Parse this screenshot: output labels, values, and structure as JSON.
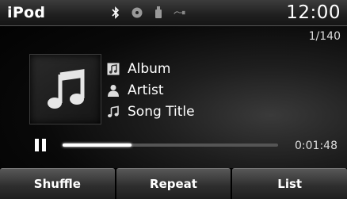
{
  "header": {
    "title": "iPod",
    "clock": "12:00",
    "status_icons": [
      "bluetooth-icon",
      "disc-icon",
      "usb-device-icon",
      "aux-cable-icon"
    ]
  },
  "player": {
    "track_counter": "1/140",
    "album": "Album",
    "artist": "Artist",
    "song_title": "Song Title",
    "elapsed": "0:01:48",
    "progress_fraction": 0.32,
    "state": "playing"
  },
  "buttons": {
    "shuffle": "Shuffle",
    "repeat": "Repeat",
    "list": "List"
  },
  "colors": {
    "background": "#000000",
    "text": "#ffffff",
    "progress_track": "#555555"
  }
}
